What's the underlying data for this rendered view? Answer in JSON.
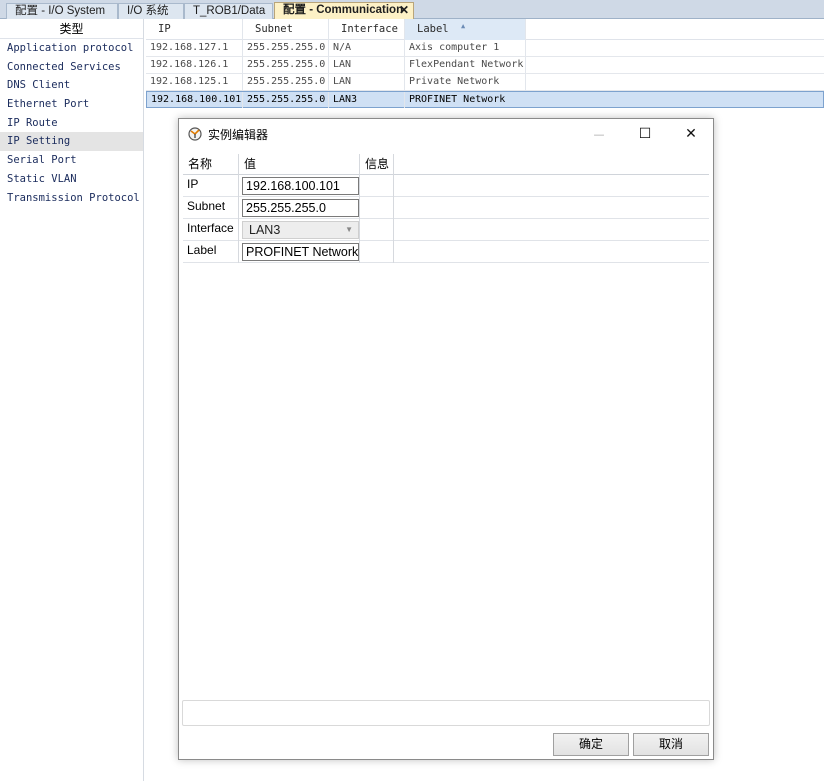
{
  "tabs": [
    {
      "label": "配置 - I/O System",
      "active": false
    },
    {
      "label": "I/O 系统",
      "active": false
    },
    {
      "label": "T_ROB1/Data",
      "active": false
    },
    {
      "label": "配置 - Communication",
      "active": true
    }
  ],
  "tab_close": "✕",
  "type_panel": {
    "header": "类型",
    "items": [
      "Application protocol",
      "Connected Services",
      "DNS Client",
      "Ethernet Port",
      "IP Route",
      "IP Setting",
      "Serial Port",
      "Static VLAN",
      "Transmission Protocol"
    ],
    "selected": "IP Setting"
  },
  "grid": {
    "columns": [
      "IP",
      "Subnet",
      "Interface",
      "Label"
    ],
    "sort_indicator": "▲",
    "rows": [
      {
        "ip": "192.168.127.1",
        "subnet": "255.255.255.0",
        "interface": "N/A",
        "label": "Axis computer 1"
      },
      {
        "ip": "192.168.126.1",
        "subnet": "255.255.255.0",
        "interface": "LAN",
        "label": "FlexPendant Network"
      },
      {
        "ip": "192.168.125.1",
        "subnet": "255.255.255.0",
        "interface": "LAN",
        "label": "Private Network"
      },
      {
        "ip": "192.168.100.101",
        "subnet": "255.255.255.0",
        "interface": "LAN3",
        "label": "PROFINET Network"
      }
    ]
  },
  "dialog": {
    "title": "实例编辑器",
    "minimize": "—",
    "maximize": "☐",
    "close": "✕",
    "columns": [
      "名称",
      "值",
      "信息"
    ],
    "fields": {
      "ip": {
        "name": "IP",
        "value": "192.168.100.101"
      },
      "subnet": {
        "name": "Subnet",
        "value": "255.255.255.0"
      },
      "interface": {
        "name": "Interface",
        "value": "LAN3"
      },
      "label": {
        "name": "Label",
        "value": "PROFINET Network"
      }
    },
    "ok_label": "确定",
    "cancel_label": "取消"
  }
}
